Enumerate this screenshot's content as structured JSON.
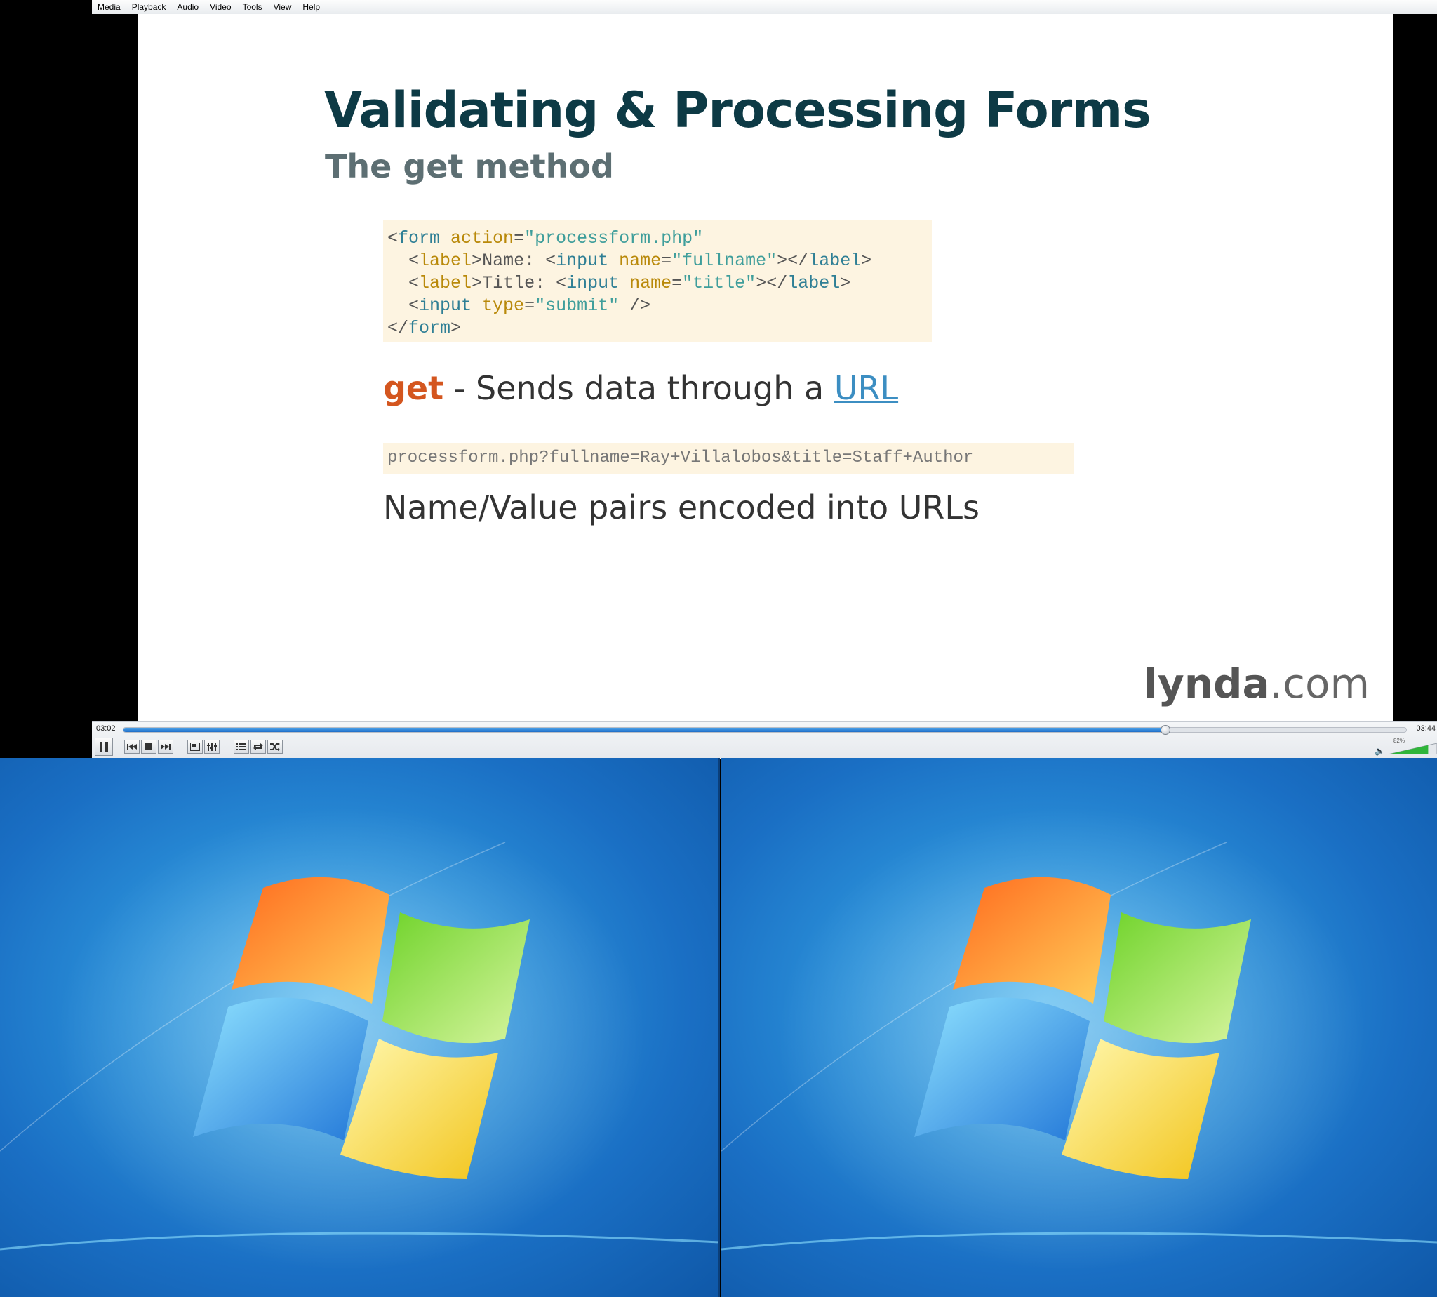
{
  "menu": {
    "items": [
      "Media",
      "Playback",
      "Audio",
      "Video",
      "Tools",
      "View",
      "Help"
    ]
  },
  "slide": {
    "title": "Validating & Processing Forms",
    "subtitle": "The get method",
    "code": {
      "line1": {
        "open": "<",
        "tag": "form",
        "attr": " action",
        "eq": "=",
        "val": "\"processform.php\""
      },
      "line2": {
        "indent": "  ",
        "lt": "<",
        "tag": "label",
        "gt": ">",
        "text": "Name: ",
        "lt2": "<",
        "tag2": "input",
        "attr": " name",
        "eq": "=",
        "val": "\"fullname\"",
        "close": "></",
        "tag3": "label",
        "end": ">"
      },
      "line3": {
        "indent": "  ",
        "lt": "<",
        "tag": "label",
        "gt": ">",
        "text": "Title: ",
        "lt2": "<",
        "tag2": "input",
        "attr": " name",
        "eq": "=",
        "val": "\"title\"",
        "close": "></",
        "tag3": "label",
        "end": ">"
      },
      "line4": {
        "indent": "  ",
        "lt": "<",
        "tag": "input",
        "attr": " type",
        "eq": "=",
        "val": "\"submit\"",
        "end": " />"
      },
      "line5": {
        "close": "</",
        "tag": "form",
        "end": ">"
      }
    },
    "get_keyword": "get",
    "get_description": " - Sends data through a ",
    "get_link": "URL",
    "url_example": "processform.php?fullname=Ray+Villalobos&title=Staff+Author",
    "pairs_text": "Name/Value pairs encoded into URLs",
    "logo_main": "lynda",
    "logo_suffix": ".com"
  },
  "player": {
    "time_elapsed": "03:02",
    "time_total": "03:44",
    "progress_fraction": 0.8125,
    "volume_label": "82%",
    "volume_fraction": 0.82,
    "buttons": [
      {
        "name": "pause-button",
        "icon": "pause-icon"
      },
      {
        "name": "previous-button",
        "icon": "previous-icon"
      },
      {
        "name": "stop-button",
        "icon": "stop-icon"
      },
      {
        "name": "next-button",
        "icon": "next-icon"
      },
      {
        "name": "fullscreen-button",
        "icon": "fullscreen-icon"
      },
      {
        "name": "extended-settings-button",
        "icon": "equalizer-icon"
      },
      {
        "name": "playlist-button",
        "icon": "playlist-icon"
      },
      {
        "name": "loop-button",
        "icon": "loop-icon"
      },
      {
        "name": "shuffle-button",
        "icon": "shuffle-icon"
      }
    ]
  },
  "colors": {
    "title": "#0d3a45",
    "get_keyword": "#d4561f",
    "link": "#3c8ec2",
    "code_background": "#fdf4e1",
    "seek_fill": "#1f6fc9",
    "volume_fill": "#2fb53a"
  }
}
